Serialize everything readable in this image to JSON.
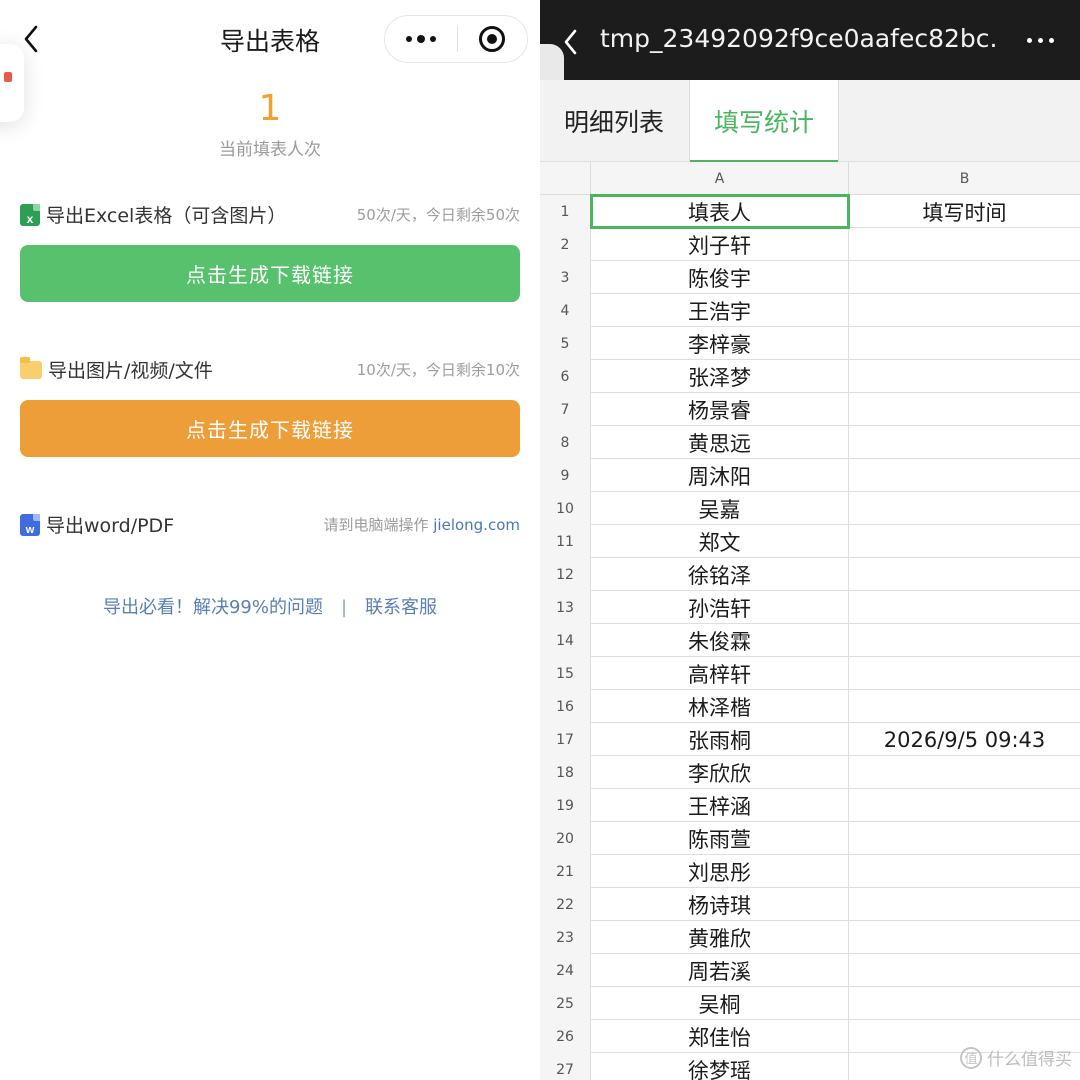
{
  "left": {
    "title": "导出表格",
    "count": "1",
    "count_label": "当前填表人次",
    "excel": {
      "label": "导出Excel表格（可含图片）",
      "quota": "50次/天，今日剩余50次",
      "button": "点击生成下载链接"
    },
    "media": {
      "label": "导出图片/视频/文件",
      "quota": "10次/天，今日剩余10次",
      "button": "点击生成下载链接"
    },
    "word": {
      "label": "导出word/PDF",
      "hint": "请到电脑端操作",
      "link": "jielong.com"
    },
    "help": {
      "faq": "导出必看！解决99%的问题",
      "separator": "|",
      "service": "联系客服"
    }
  },
  "right": {
    "file_title": "tmp_23492092f9ce0aafec82bc...",
    "tabs": [
      "明细列表",
      "填写统计"
    ],
    "active_tab": "填写统计",
    "columns": [
      "A",
      "B"
    ],
    "rows": [
      {
        "n": "1",
        "a": "填表人",
        "b": "填写时间"
      },
      {
        "n": "2",
        "a": "刘子轩",
        "b": ""
      },
      {
        "n": "3",
        "a": "陈俊宇",
        "b": ""
      },
      {
        "n": "4",
        "a": "王浩宇",
        "b": ""
      },
      {
        "n": "5",
        "a": "李梓豪",
        "b": ""
      },
      {
        "n": "6",
        "a": "张泽梦",
        "b": ""
      },
      {
        "n": "7",
        "a": "杨景睿",
        "b": ""
      },
      {
        "n": "8",
        "a": "黄思远",
        "b": ""
      },
      {
        "n": "9",
        "a": "周沐阳",
        "b": ""
      },
      {
        "n": "10",
        "a": "吴嘉",
        "b": ""
      },
      {
        "n": "11",
        "a": "郑文",
        "b": ""
      },
      {
        "n": "12",
        "a": "徐铭泽",
        "b": ""
      },
      {
        "n": "13",
        "a": "孙浩轩",
        "b": ""
      },
      {
        "n": "14",
        "a": "朱俊霖",
        "b": ""
      },
      {
        "n": "15",
        "a": "高梓轩",
        "b": ""
      },
      {
        "n": "16",
        "a": "林泽楷",
        "b": ""
      },
      {
        "n": "17",
        "a": "张雨桐",
        "b": "2026/9/5 09:43"
      },
      {
        "n": "18",
        "a": "李欣欣",
        "b": ""
      },
      {
        "n": "19",
        "a": "王梓涵",
        "b": ""
      },
      {
        "n": "20",
        "a": "陈雨萱",
        "b": ""
      },
      {
        "n": "21",
        "a": "刘思彤",
        "b": ""
      },
      {
        "n": "22",
        "a": "杨诗琪",
        "b": ""
      },
      {
        "n": "23",
        "a": "黄雅欣",
        "b": ""
      },
      {
        "n": "24",
        "a": "周若溪",
        "b": ""
      },
      {
        "n": "25",
        "a": "吴桐",
        "b": ""
      },
      {
        "n": "26",
        "a": "郑佳怡",
        "b": ""
      },
      {
        "n": "27",
        "a": "徐梦瑶",
        "b": ""
      }
    ],
    "watermark": "什么值得买"
  },
  "colors": {
    "green_button": "#58c16d",
    "orange_button": "#ee9e38",
    "accent_green": "#4bb560",
    "count_orange": "#f0a131",
    "link_blue": "#5a7fb3"
  }
}
